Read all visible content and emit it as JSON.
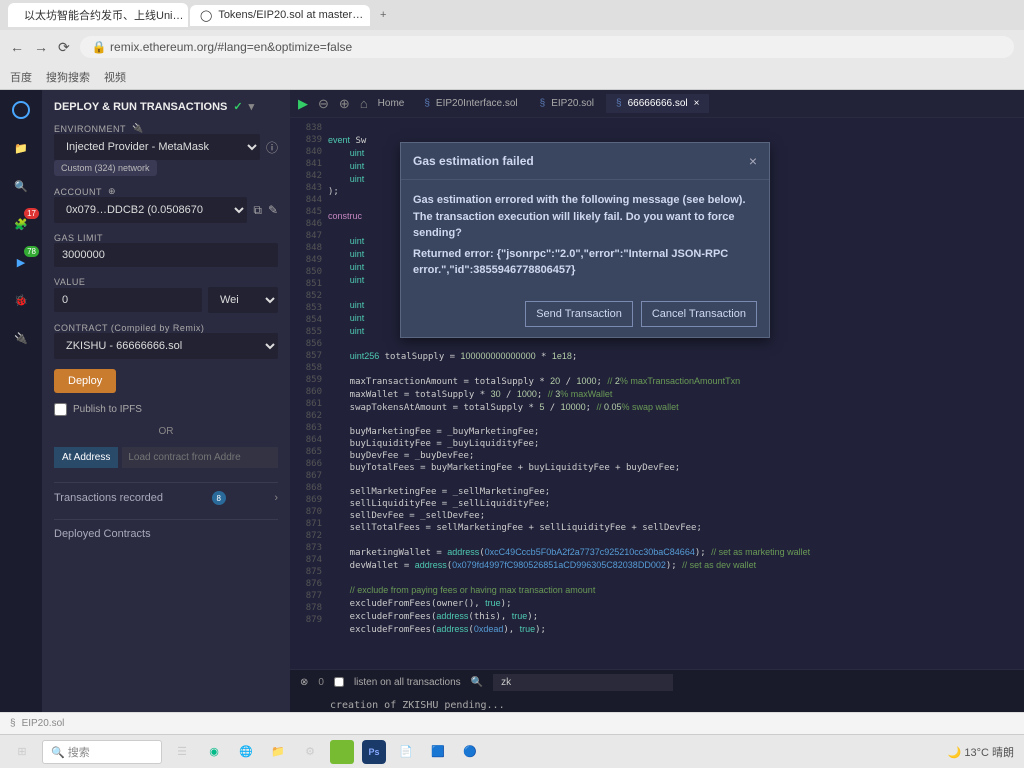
{
  "browser": {
    "tabs": [
      {
        "title": "以太坊智能合约发币、上线Uni…",
        "favicon_color": "#c00"
      },
      {
        "title": "Tokens/EIP20.sol at master…",
        "favicon": "github"
      }
    ],
    "url": "remix.ethereum.org/#lang=en&optimize=false",
    "bookmarks": [
      "百度",
      "搜狗搜索",
      "视频",
      "…"
    ]
  },
  "rail": {
    "badges": {
      "compile": "17",
      "deploy": "78"
    }
  },
  "deploy_panel": {
    "title": "DEPLOY & RUN TRANSACTIONS",
    "env_label": "ENVIRONMENT",
    "env_value": "Injected Provider - MetaMask",
    "network_chip": "Custom (324) network",
    "account_label": "ACCOUNT",
    "account_value": "0x079…DDCB2 (0.0508670",
    "gas_label": "GAS LIMIT",
    "gas_value": "3000000",
    "value_label": "VALUE",
    "value_amount": "0",
    "value_unit": "Wei",
    "contract_label": "CONTRACT (Compiled by Remix)",
    "contract_value": "ZKISHU - 66666666.sol",
    "deploy_btn": "Deploy",
    "ipfs_label": "Publish to IPFS",
    "or": "OR",
    "at_address_btn": "At Address",
    "at_address_placeholder": "Load contract from Addre",
    "tx_recorded": "Transactions recorded",
    "tx_count": "8",
    "deployed": "Deployed Contracts"
  },
  "editor": {
    "home": "Home",
    "tabs": [
      "EIP20Interface.sol",
      "EIP20.sol",
      "66666666.sol"
    ],
    "active_tab": 2,
    "line_start": 838,
    "line_end": 880,
    "code_lines": [
      "",
      "event Sw",
      "    uint",
      "    uint",
      "    uint",
      ");",
      "",
      "construc",
      "",
      "    uint",
      "    uint",
      "    uint",
      "    uint",
      "",
      "    uint",
      "    uint",
      "    uint",
      "",
      "    uint256 totalSupply = 100000000000000 * 1e18;",
      "",
      "    maxTransactionAmount = totalSupply * 20 / 1000; // 2% maxTransactionAmountTxn",
      "    maxWallet = totalSupply * 30 / 1000; // 3% maxWallet",
      "    swapTokensAtAmount = totalSupply * 5 / 10000; // 0.05% swap wallet",
      "",
      "    buyMarketingFee = _buyMarketingFee;",
      "    buyLiquidityFee = _buyLiquidityFee;",
      "    buyDevFee = _buyDevFee;",
      "    buyTotalFees = buyMarketingFee + buyLiquidityFee + buyDevFee;",
      "",
      "    sellMarketingFee = _sellMarketingFee;",
      "    sellLiquidityFee = _sellLiquidityFee;",
      "    sellDevFee = _sellDevFee;",
      "    sellTotalFees = sellMarketingFee + sellLiquidityFee + sellDevFee;",
      "",
      "    marketingWallet = address(0xcC49Cccb5F0bA2f2a7737c925210cc30baC84664); // set as marketing wallet",
      "    devWallet = address(0x079fd4997fC980526851aCD996305C82038DD002); // set as dev wallet",
      "",
      "    // exclude from paying fees or having max transaction amount",
      "    excludeFromFees(owner(), true);",
      "    excludeFromFees(address(this), true);",
      "    excludeFromFees(address(0xdead), true);",
      ""
    ]
  },
  "modal": {
    "title": "Gas estimation failed",
    "body_line1": "Gas estimation errored with the following message (see below). The transaction execution will likely fail. Do you want to force sending?",
    "body_line2": "Returned error: {\"jsonrpc\":\"2.0\",\"error\":\"Internal JSON-RPC error.\",\"id\":3855946778806457}",
    "send_btn": "Send Transaction",
    "cancel_btn": "Cancel Transaction"
  },
  "terminal": {
    "listen_label": "listen on all transactions",
    "search_value": "zk",
    "output": "creation of ZKISHU pending..."
  },
  "bottom_file": "EIP20.sol",
  "taskbar": {
    "search_placeholder": "搜索",
    "weather": "13°C 晴朗"
  }
}
